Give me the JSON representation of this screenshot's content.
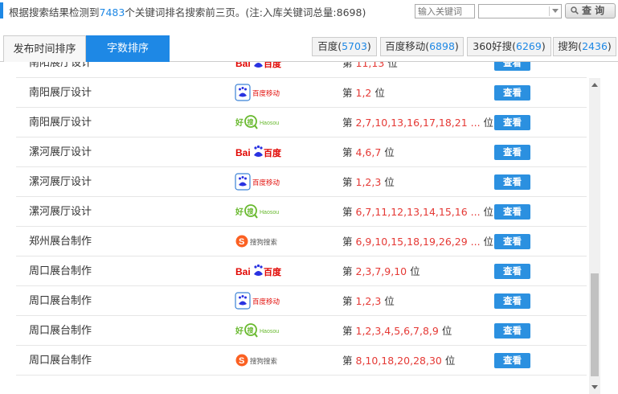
{
  "summary": {
    "prefix": "根据搜索结果检测到",
    "count": "7483",
    "suffix": "个关键词排名搜索前三页。(注:入库关键词总量:8698)"
  },
  "search": {
    "placeholder": "输入关键词",
    "select_value": "",
    "button_label": "查 询"
  },
  "tabs": [
    {
      "label": "发布时间排序",
      "active": false
    },
    {
      "label": "字数排序",
      "active": true
    }
  ],
  "engines": [
    {
      "name": "百度",
      "count": "5703"
    },
    {
      "name": "百度移动",
      "count": "6898"
    },
    {
      "name": "360好搜",
      "count": "6269"
    },
    {
      "name": "搜狗",
      "count": "2436"
    }
  ],
  "colors": {
    "accent": "#1e88e5",
    "rank": "#e53935",
    "view_button": "#2b90e0"
  },
  "rank_prefix": "第",
  "rank_suffix": "位",
  "view_label": "查看",
  "rows": [
    {
      "keyword": "南阳展厅设计",
      "engine": "baidu",
      "positions": "11,13"
    },
    {
      "keyword": "南阳展厅设计",
      "engine": "baidu-mobile",
      "positions": "1,2"
    },
    {
      "keyword": "南阳展厅设计",
      "engine": "haosou",
      "positions": "2,7,10,13,16,17,18,21 ..."
    },
    {
      "keyword": "漯河展厅设计",
      "engine": "baidu",
      "positions": "4,6,7"
    },
    {
      "keyword": "漯河展厅设计",
      "engine": "baidu-mobile",
      "positions": "1,2,3"
    },
    {
      "keyword": "漯河展厅设计",
      "engine": "haosou",
      "positions": "6,7,11,12,13,14,15,16 ..."
    },
    {
      "keyword": "郑州展台制作",
      "engine": "sogou",
      "positions": "6,9,10,15,18,19,26,29 ..."
    },
    {
      "keyword": "周口展台制作",
      "engine": "baidu",
      "positions": "2,3,7,9,10"
    },
    {
      "keyword": "周口展台制作",
      "engine": "baidu-mobile",
      "positions": "1,2,3"
    },
    {
      "keyword": "周口展台制作",
      "engine": "haosou",
      "positions": "1,2,3,4,5,6,7,8,9"
    },
    {
      "keyword": "周口展台制作",
      "engine": "sogou",
      "positions": "8,10,18,20,28,30"
    }
  ],
  "logos": {
    "baidu": {
      "icon": "baidu-logo",
      "text_a": "Bai",
      "text_b": "百度"
    },
    "baidu-mobile": {
      "icon": "baidu-mobile-logo",
      "text": "百度移动"
    },
    "haosou": {
      "icon": "haosou-logo",
      "text": "好",
      "text_b": "搜",
      "text_c": "Haosou"
    },
    "sogou": {
      "icon": "sogou-logo",
      "text": "搜狗搜索"
    }
  }
}
